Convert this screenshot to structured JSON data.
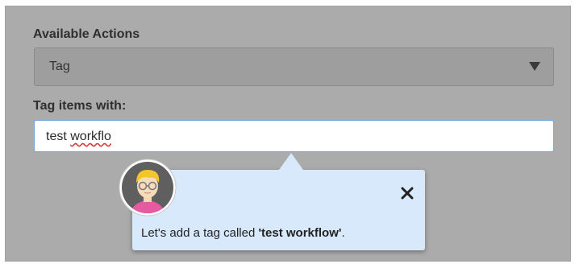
{
  "form": {
    "actions_label": "Available Actions",
    "actions_selected": "Tag",
    "tag_label": "Tag items with:",
    "tag_input_value_start": "test ",
    "tag_input_value_misspelled": "workflo"
  },
  "tooltip": {
    "message_prefix": "Let's add a tag called ",
    "message_highlight": "'test workflow'",
    "message_suffix": ".",
    "close_icon": "close-icon"
  },
  "colors": {
    "overlay": "#ababab",
    "tooltip_bg": "#d8e9fb",
    "input_focus_border": "#6fa3d9"
  }
}
